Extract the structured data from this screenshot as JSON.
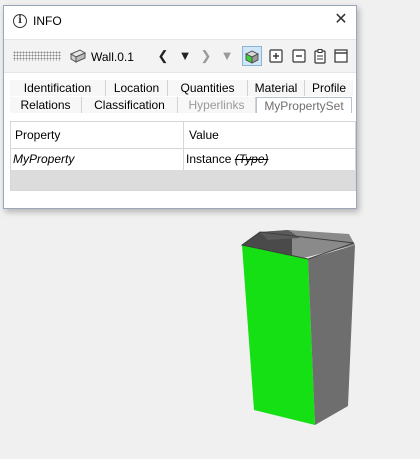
{
  "window": {
    "title": "INFO",
    "info_icon_glyph": "i",
    "close_glyph": "✕"
  },
  "toolbar": {
    "object_name": "Wall.0.1",
    "prev_glyph": "❮",
    "dropdown_glyph": "▼",
    "next_glyph": "❯",
    "disabled_dropdown_glyph": "▼"
  },
  "tabs": {
    "row1": [
      "Identification",
      "Location",
      "Quantities",
      "Material",
      "Profile"
    ],
    "row2": [
      "Relations",
      "Classification",
      "Hyperlinks",
      "MyPropertySet"
    ],
    "selected": "MyPropertySet"
  },
  "table": {
    "headers": [
      "Property",
      "Value"
    ],
    "rows": [
      {
        "property": "MyProperty",
        "value_prefix": "Instance",
        "value_struck": "(Type)"
      }
    ]
  },
  "colors": {
    "accent_green": "#14e014",
    "wall_gray": "#6e6e6e",
    "selected_tab_text": "#6f6f6f"
  },
  "icons": [
    "info-icon",
    "close-icon",
    "wall-icon",
    "arrow-left-icon",
    "dropdown-icon",
    "arrow-right-icon",
    "isolate-icon",
    "add-icon",
    "remove-icon",
    "clipboard-icon",
    "window-icon"
  ]
}
